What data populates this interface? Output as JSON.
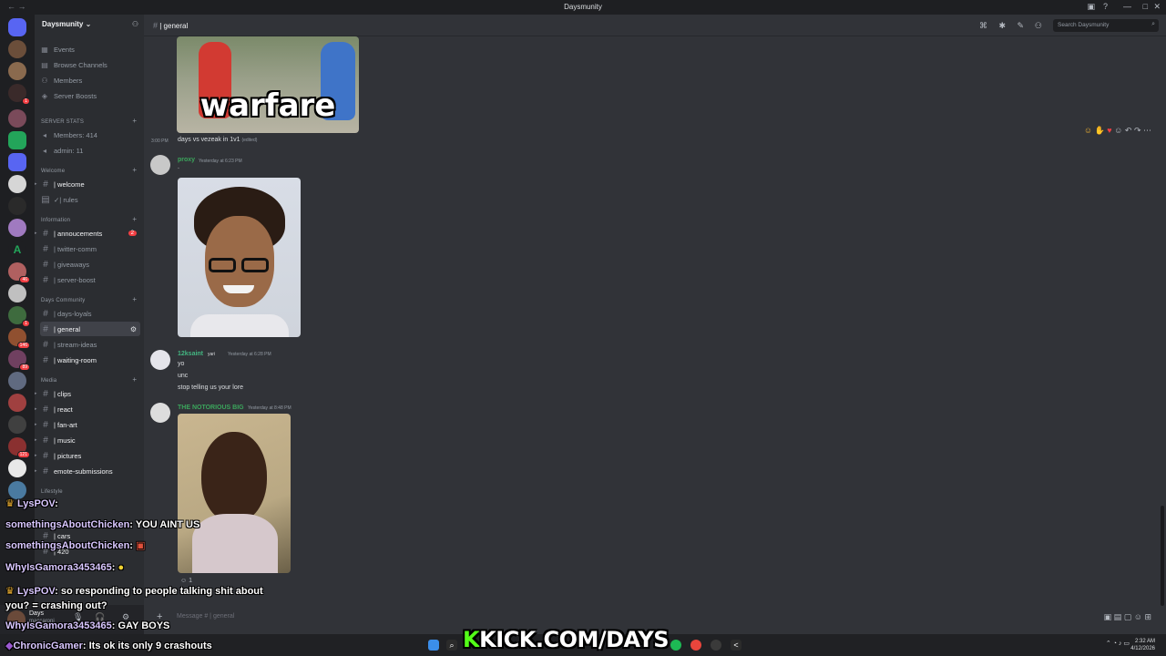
{
  "window": {
    "title": "Daysmunity"
  },
  "server": {
    "name": "Daysmunity"
  },
  "sidebar": {
    "top_items": [
      {
        "label": "Events",
        "icon": "calendar-icon"
      },
      {
        "label": "Browse Channels",
        "icon": "browse-icon"
      },
      {
        "label": "Members",
        "icon": "members-icon"
      },
      {
        "label": "Server Boosts",
        "icon": "boost-icon"
      }
    ],
    "categories": {
      "server_stats": "SERVER STATS",
      "welcome": "Welcome",
      "information": "Information",
      "days_community": "Days Community",
      "media": "Media",
      "lifestyle": "Lifestyle"
    },
    "stats": {
      "members": "Members: 414",
      "admin": "admin: 11"
    },
    "channels": {
      "welcome": "| welcome",
      "rules": "✓| rules",
      "annoucements": "| annoucements",
      "annoucements_badge": "2",
      "twitter": "| twitter-comm",
      "giveaways": "| giveaways",
      "server_boost": "| server-boost",
      "days_loyals": "| days-loyals",
      "general": "| general",
      "stream_ideas": "| stream-ideas",
      "waiting_room": "| waiting-room",
      "clips": "| clips",
      "react": "| react",
      "fan_art": "| fan-art",
      "music": "| music",
      "pictures": "| pictures",
      "emote_submissions": "emote-submissions",
      "cars": "| cars",
      "c420": "| 420"
    },
    "user": {
      "name": "Days",
      "status": "maccaroni"
    }
  },
  "header": {
    "channel": "| general",
    "search_placeholder": "Search Daysmunity"
  },
  "messages": [
    {
      "time": "3:00 PM",
      "text": "days vs vezeak in 1v1",
      "edited": "(edited)",
      "image_caption": "warfare"
    },
    {
      "author": "proxy",
      "timestamp": "Yesterday at 6:23 PM",
      "text": "."
    },
    {
      "author": "12ksaint",
      "tag": "yari",
      "timestamp": "Yesterday at 6:28 PM",
      "lines": [
        "yo",
        "unc",
        "stop telling us your lore"
      ]
    },
    {
      "author": "THE NOTORIOUS BIG",
      "timestamp": "Yesterday at 8:48 PM",
      "reaction_count": "1"
    }
  ],
  "composer": {
    "placeholder": "Message #  | general"
  },
  "overlay": {
    "lines": [
      {
        "user": "LysPOV",
        "text": ""
      },
      {
        "user": "somethingsAboutChicken",
        "text": "YOU AINT US"
      },
      {
        "user": "somethingsAboutChicken",
        "text": ""
      },
      {
        "user": "WhyIsGamora3453465",
        "text": ""
      },
      {
        "user": "LysPOV",
        "text": "so responding to people talking shit about"
      },
      {
        "user": "",
        "text": "you? = crashing out?"
      },
      {
        "user": "WhyIsGamora3453465",
        "text": "GAY BOYS"
      },
      {
        "user": "ChronicGamer",
        "text": "Its ok its only 9 crashouts"
      }
    ],
    "kick_banner": "KICK.COM/DAYS"
  },
  "taskbar": {
    "time": "2:32 AM",
    "date": "4/12/2026"
  },
  "colors": {
    "green_author": "#3ba55c",
    "name_green": "#43b581",
    "accent": "#5865f2",
    "kick_green": "#53fc18"
  }
}
